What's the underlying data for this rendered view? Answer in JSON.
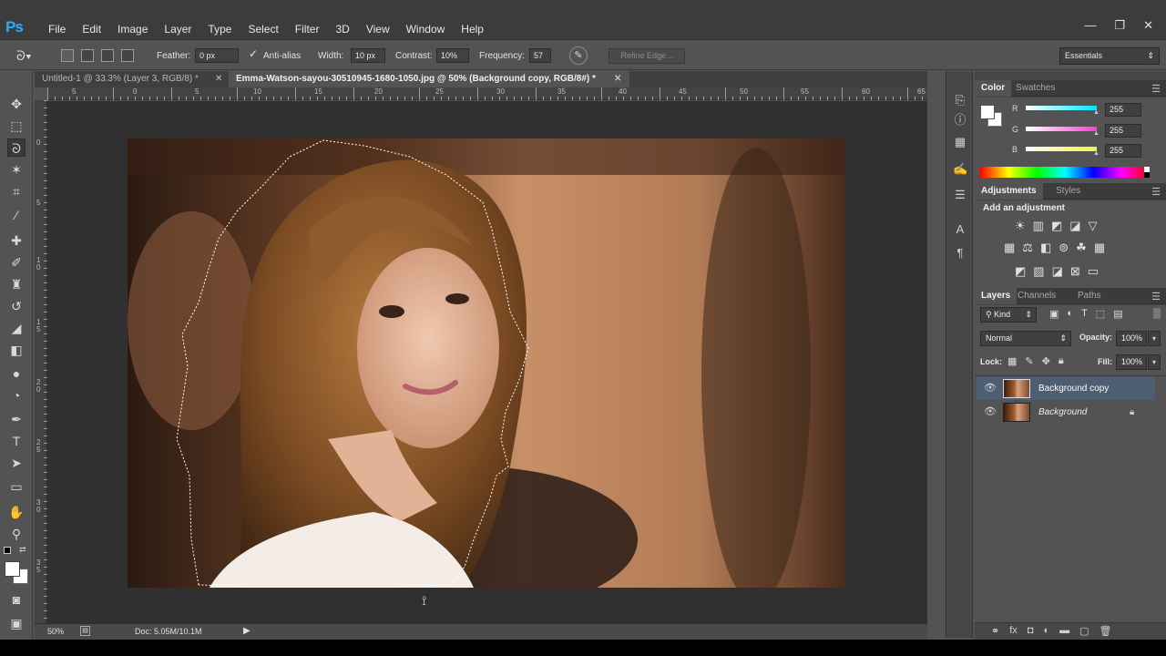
{
  "app": {
    "logo": "Ps"
  },
  "menu": [
    "File",
    "Edit",
    "Image",
    "Layer",
    "Type",
    "Select",
    "Filter",
    "3D",
    "View",
    "Window",
    "Help"
  ],
  "window_controls": {
    "minimize": "—",
    "restore": "❐",
    "close": "✕"
  },
  "options": {
    "feather_label": "Feather:",
    "feather_value": "0 px",
    "antialias_label": "Anti-alias",
    "antialias_checked": true,
    "width_label": "Width:",
    "width_value": "10 px",
    "contrast_label": "Contrast:",
    "contrast_value": "10%",
    "frequency_label": "Frequency:",
    "frequency_value": "57",
    "refine_edge": "Refine Edge...",
    "workspace": "Essentials"
  },
  "tabs": [
    {
      "label": "Untitled-1 @ 33.3% (Layer 3, RGB/8) *",
      "active": false
    },
    {
      "label": "Emma-Watson-sayou-30510945-1680-1050.jpg @ 50% (Background copy, RGB/8#) *",
      "active": true
    }
  ],
  "ruler": {
    "h_ticks": [
      "5",
      "0",
      "5",
      "10",
      "15",
      "20",
      "25",
      "30",
      "35",
      "40",
      "45",
      "50",
      "55",
      "60",
      "65"
    ],
    "v_ticks": [
      "0",
      "5",
      "1 0",
      "1 5",
      "2 0",
      "2 5",
      "3 0",
      "3 5"
    ]
  },
  "status": {
    "zoom": "50%",
    "doc": "Doc: 5.05M/10.1M"
  },
  "color_panel": {
    "tabs": [
      "Color",
      "Swatches"
    ],
    "channels": [
      {
        "label": "R",
        "value": "255",
        "color": "#00e5ff"
      },
      {
        "label": "G",
        "value": "255",
        "color": "#ff3ad8"
      },
      {
        "label": "B",
        "value": "255",
        "color": "#f4f23a"
      }
    ]
  },
  "adjustments_panel": {
    "tabs": [
      "Adjustments",
      "Styles"
    ],
    "heading": "Add an adjustment"
  },
  "layers_panel": {
    "tabs": [
      "Layers",
      "Channels",
      "Paths"
    ],
    "filter_kind": "Kind",
    "blend_mode": "Normal",
    "opacity_label": "Opacity:",
    "opacity_value": "100%",
    "lock_label": "Lock:",
    "fill_label": "Fill:",
    "fill_value": "100%",
    "layers": [
      {
        "name": "Background copy",
        "selected": true,
        "locked": false
      },
      {
        "name": "Background",
        "selected": false,
        "locked": true
      }
    ]
  },
  "colors": {
    "accent": "#31a8ff",
    "ui_dark": "#3c3c3c",
    "ui_mid": "#535353",
    "pasteboard": "#303030",
    "selected_layer": "#4d5d72"
  }
}
